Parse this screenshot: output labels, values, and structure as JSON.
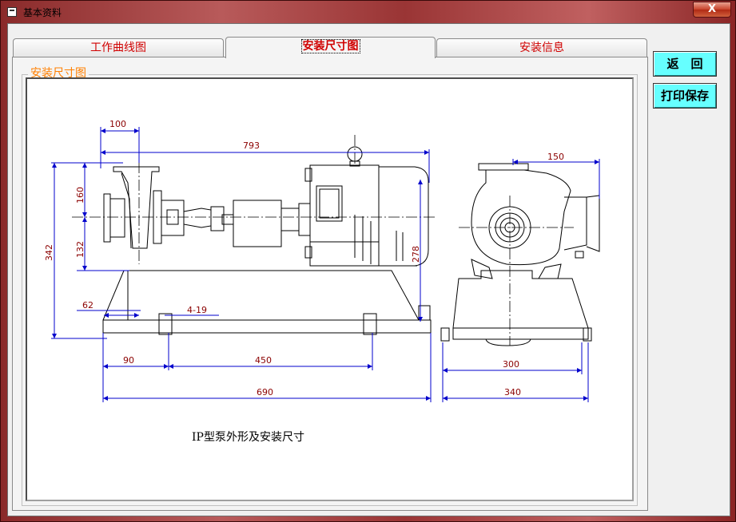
{
  "window": {
    "title": "基本资料",
    "close_label": "X"
  },
  "tabs": [
    {
      "label": "工作曲线图",
      "active": false
    },
    {
      "label": "安装尺寸图",
      "active": true
    },
    {
      "label": "安装信息",
      "active": false
    }
  ],
  "group": {
    "label": "安装尺寸图"
  },
  "drawing": {
    "caption": "IP型泵外形及安装尺寸",
    "dimensions": {
      "d100": "100",
      "d793": "793",
      "d150": "150",
      "d342": "342",
      "d160": "160",
      "d132": "132",
      "d278": "278",
      "d62": "62",
      "d4x19": "4-19",
      "d90": "90",
      "d450": "450",
      "d690": "690",
      "d300": "300",
      "d340": "340"
    },
    "colors": {
      "dimension": "#0000cc",
      "dim_text": "#8b0000",
      "outline": "#000000"
    }
  },
  "buttons": {
    "back": "返　回",
    "print_save": "打印保存"
  }
}
